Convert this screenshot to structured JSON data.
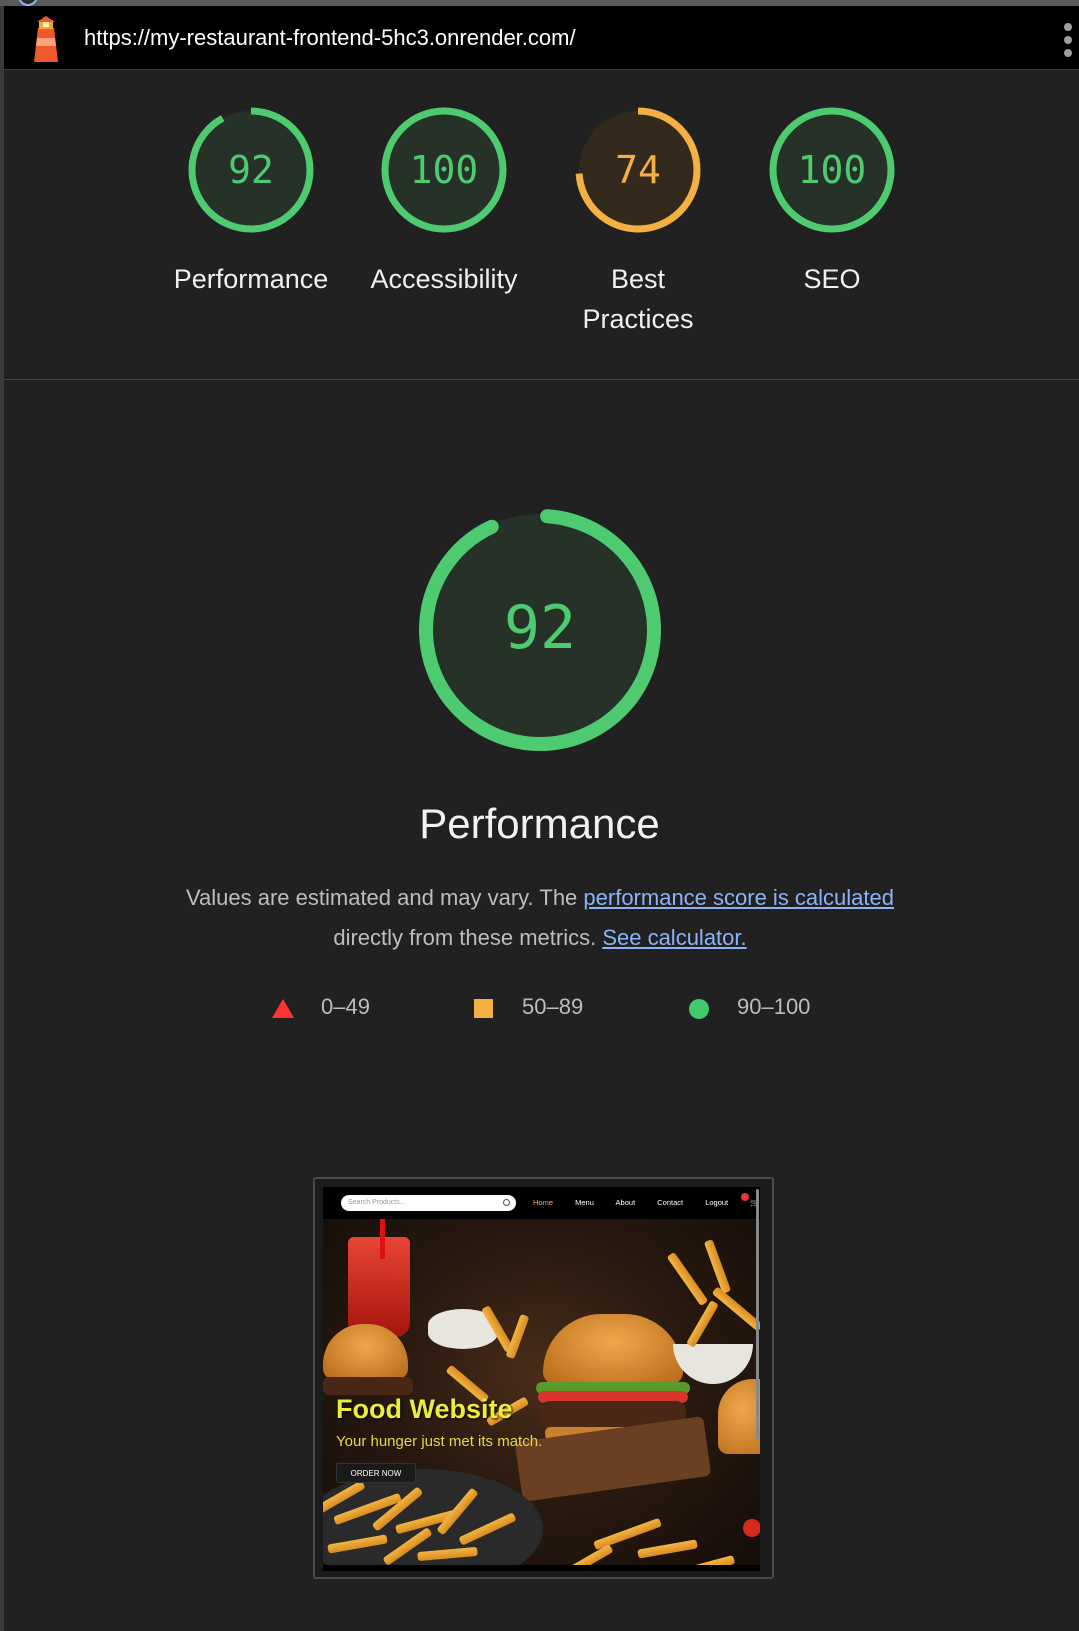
{
  "topbar": {
    "url": "https://my-restaurant-frontend-5hc3.onrender.com/",
    "logo_icon": "lighthouse-icon",
    "menu_icon": "more-vert-icon"
  },
  "colors": {
    "pass": "#4ecb71",
    "average": "#f4b042",
    "fail": "#ff4e42",
    "link": "#8ab4f8",
    "background": "#212121"
  },
  "categories": [
    {
      "score": "92",
      "score_value": 92,
      "label": "Performance",
      "rating": "pass"
    },
    {
      "score": "100",
      "score_value": 100,
      "label": "Accessibility",
      "rating": "pass"
    },
    {
      "score": "74",
      "score_value": 74,
      "label_line1": "Best",
      "label_line2": "Practices",
      "rating": "average"
    },
    {
      "score": "100",
      "score_value": 100,
      "label": "SEO",
      "rating": "pass"
    }
  ],
  "performance": {
    "score": "92",
    "score_value": 92,
    "title": "Performance",
    "desc_prefix": "Values are estimated and may vary. The ",
    "desc_link": "performance score is calculated",
    "desc_middle": " directly from these metrics. ",
    "desc_link2": "See calculator."
  },
  "legend": [
    {
      "range": "0–49",
      "shape": "triangle-icon"
    },
    {
      "range": "50–89",
      "shape": "square-icon"
    },
    {
      "range": "90–100",
      "shape": "circle-icon"
    }
  ],
  "screenshot": {
    "search_placeholder": "Search Products...",
    "nav": [
      "Home",
      "Menu",
      "About",
      "Contact",
      "Logout",
      "🛒 Cart"
    ],
    "hero_title": "Food Website",
    "hero_subtitle": "Your hunger just met its match.",
    "hero_button": "ORDER NOW"
  }
}
